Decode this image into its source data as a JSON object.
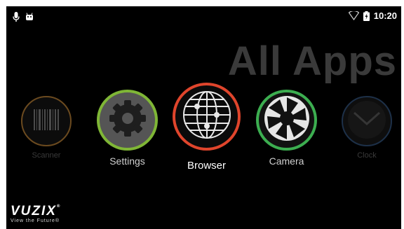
{
  "status_bar": {
    "left_icons": [
      "microphone-icon",
      "android-icon"
    ],
    "right_icons": [
      "wifi-icon",
      "battery-charging-icon"
    ],
    "time": "10:20"
  },
  "title": "All Apps",
  "apps": [
    {
      "label": "Scanner",
      "icon": "barcode-icon",
      "ring_color": "#6b4a1f",
      "state": "dimmed"
    },
    {
      "label": "Settings",
      "icon": "gear-icon",
      "ring_color": "#7fb636",
      "state": "normal"
    },
    {
      "label": "Browser",
      "icon": "globe-icon",
      "ring_color": "#e0452c",
      "state": "selected"
    },
    {
      "label": "Camera",
      "icon": "aperture-icon",
      "ring_color": "#3cae50",
      "state": "normal"
    },
    {
      "label": "Clock",
      "icon": "clock-icon",
      "ring_color": "#1d3048",
      "state": "dimmed"
    }
  ],
  "logo": {
    "wordmark": "VUZIX",
    "trademark": "®",
    "tagline": "View the Future®"
  }
}
